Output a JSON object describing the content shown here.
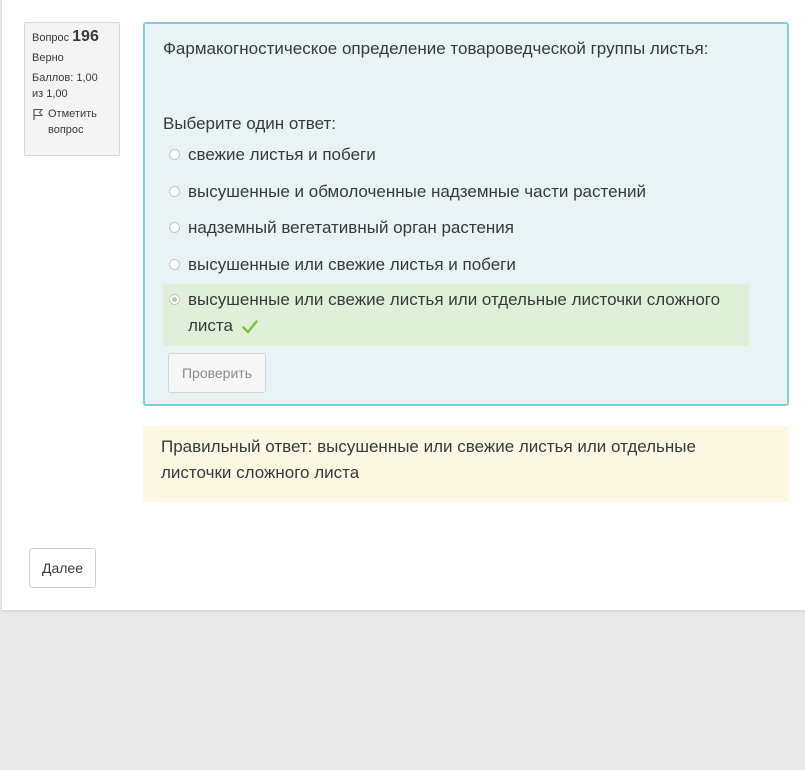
{
  "question_info": {
    "label": "Вопрос",
    "number": "196",
    "state": "Верно",
    "grade": "Баллов: 1,00 из 1,00",
    "flag_label": "Отметить вопрос"
  },
  "question": {
    "text": "Фармакогностическое определение товароведческой группы листья:",
    "prompt": "Выберите один ответ:",
    "options": [
      {
        "label": "свежие листья и побеги",
        "selected": false
      },
      {
        "label": "высушенные и обмолоченные надземные части растений",
        "selected": false
      },
      {
        "label": "надземный вегетативный орган растения",
        "selected": false
      },
      {
        "label": "высушенные или свежие листья и побеги",
        "selected": false
      },
      {
        "label": "высушенные или свежие листья или отдельные листочки сложного листа",
        "selected": true,
        "correct": true
      }
    ],
    "check_button": "Проверить"
  },
  "feedback": {
    "right_answer": "Правильный ответ: высушенные или свежие листья или отдельные листочки сложного листа"
  },
  "navigation": {
    "next_button": "Далее"
  },
  "colors": {
    "question_bg": "#e7f3f5",
    "question_border": "#7ccfd8",
    "correct_bg": "#dff0d8",
    "answer_bg": "#fcf8e3",
    "check_mark": "#7cc142"
  }
}
